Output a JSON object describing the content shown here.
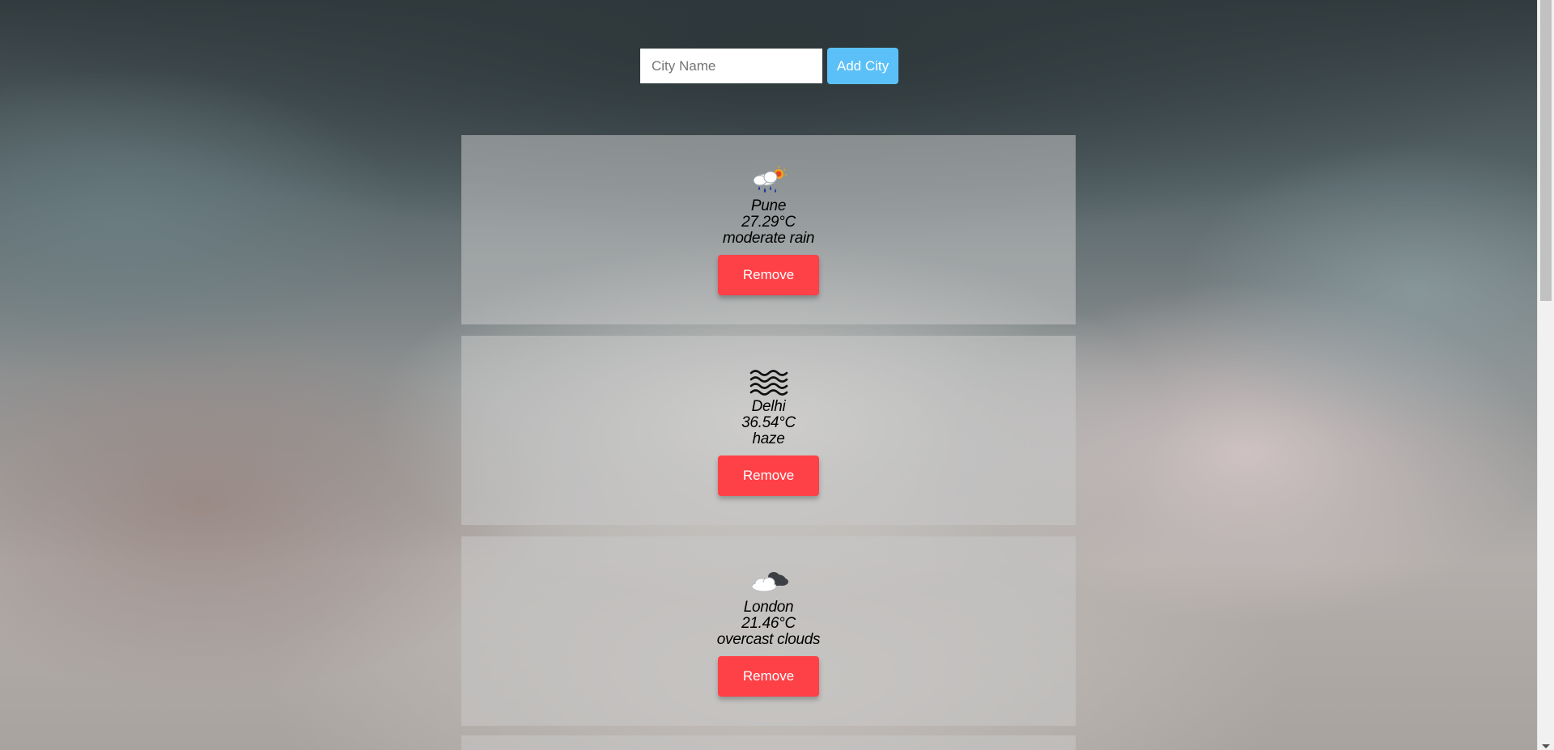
{
  "form": {
    "input_placeholder": "City Name",
    "input_value": "",
    "add_button_label": "Add City"
  },
  "cards": [
    {
      "city": "Pune",
      "temp": "27.29°C",
      "description": "moderate rain",
      "icon": "rain-sun-icon",
      "remove_label": "Remove"
    },
    {
      "city": "Delhi",
      "temp": "36.54°C",
      "description": "haze",
      "icon": "haze-icon",
      "remove_label": "Remove"
    },
    {
      "city": "London",
      "temp": "21.46°C",
      "description": "overcast clouds",
      "icon": "overcast-clouds-icon",
      "remove_label": "Remove"
    }
  ],
  "colors": {
    "add_button": "#5bc0f8",
    "remove_button": "#fe4147",
    "card_background": "rgba(200,200,200,0.55)"
  }
}
